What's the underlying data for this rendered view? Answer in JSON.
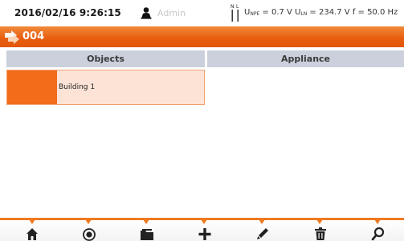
{
  "status": {
    "datetime": "2016/02/16 9:26:15",
    "user": "Admin",
    "terminal_labels": "N L",
    "unpe_label": "U",
    "unpe_sub": "NPE",
    "unpe_value": " = 0.7 V ",
    "uln_label": "U",
    "uln_sub": "LN",
    "uln_value": " = 234.7 V ",
    "freq": "f = 50.0 Hz"
  },
  "title": {
    "icon": "structure-icon",
    "label": "004"
  },
  "columns": {
    "objects": "Objects",
    "appliance": "Appliance"
  },
  "tree": {
    "items": [
      {
        "label": "Building 1",
        "selected": true
      }
    ]
  },
  "toolbar": {
    "buttons": [
      "home-icon",
      "view-icon",
      "open-folder-icon",
      "add-icon",
      "edit-icon",
      "delete-icon",
      "search-icon"
    ]
  },
  "colors": {
    "accent": "#e85f10",
    "header_bg": "#cbd0dc",
    "selected_row": "#fde3d6",
    "row_marker": "#f26c1a"
  }
}
